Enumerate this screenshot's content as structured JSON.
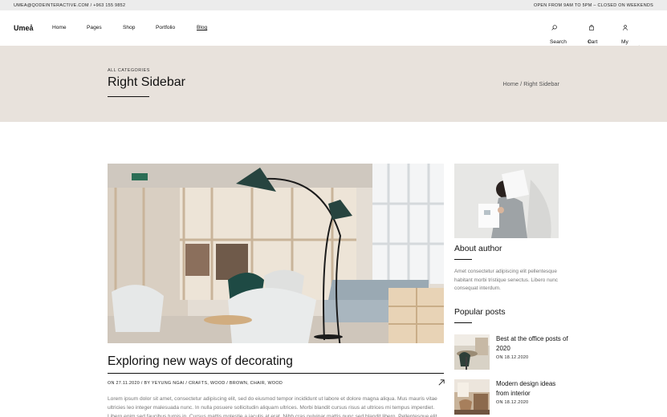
{
  "topbar": {
    "contact": "UMEA@QODEINTERACTIVE.COM / +963 155 9852",
    "hours": "OPEN FROM 9AM TO 5PM – CLOSED ON WEEKENDS"
  },
  "header": {
    "logo": "Umeå",
    "nav": [
      "Home",
      "Pages",
      "Shop",
      "Portfolio",
      "Blog"
    ],
    "search_label": "Search",
    "cart_label": "Cart",
    "cart_count": "0",
    "account_label": "My account"
  },
  "titlebar": {
    "category": "ALL CATEGORIES",
    "title": "Right Sidebar",
    "breadcrumb_home": "Home",
    "breadcrumb_sep": "/",
    "breadcrumb_current": "Right Sidebar"
  },
  "post": {
    "title": "Exploring new ways of decorating",
    "meta": "ON 27.11.2020  /  BY YEYUNG NGAI  /  CRAFTS, WOOD  /  BROWN, CHAIR, WOOD",
    "excerpt": "Lorem ipsum dolor sit amet, consectetur adipiscing elit, sed do eiusmod tempor incididunt ut labore et dolore magna aliqua. Mus mauris vitae ultricies leo integer malesuada nunc. In nulla posuere sollicitudin aliquam ultrices. Morbi blandit cursus risus at ultrices mi tempus imperdiet. Libero enim sed faucibus turpis in. Cursus mattis molestie a iaculis at erat. Nibh cras pulvinar mattis nunc sed blandit libero. Pellentesque elit ullamcorper"
  },
  "sidebar": {
    "about_title": "About author",
    "about_text": "Amet consectetur adipiscing elit pellentesque habitant morbi tristique senectus. Libero nunc consequat interdum.",
    "popular_title": "Popular posts",
    "popular": [
      {
        "title": "Best at the office posts of 2020",
        "date": "ON 18.12.2020"
      },
      {
        "title": "Modern design ideas from interior",
        "date": "ON 18.12.2020"
      }
    ]
  },
  "colors": {
    "title_band": "#e8e2dc",
    "topbar": "#ececec",
    "text": "#111111",
    "muted": "#777777"
  }
}
